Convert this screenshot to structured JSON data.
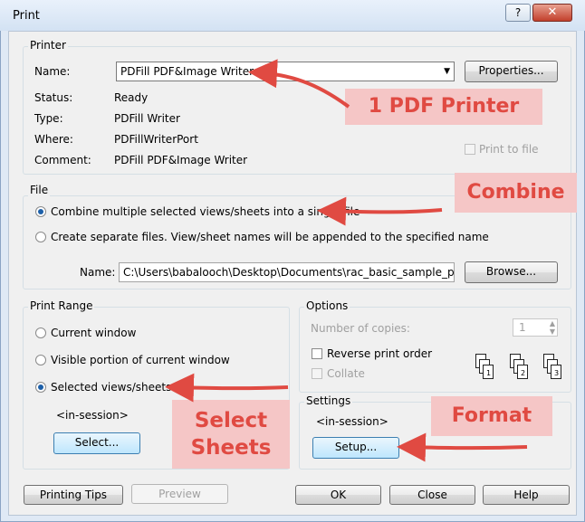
{
  "window": {
    "title": "Print",
    "help_label": "?",
    "close_label": "✕"
  },
  "printer": {
    "group_label": "Printer",
    "name_label": "Name:",
    "name_value": "PDFill PDF&Image Writer",
    "properties_label": "Properties...",
    "status_label": "Status:",
    "status_value": "Ready",
    "type_label": "Type:",
    "type_value": "PDFill Writer",
    "where_label": "Where:",
    "where_value": "PDFillWriterPort",
    "comment_label": "Comment:",
    "comment_value": "PDFill PDF&Image Writer",
    "print_to_file_label": "Print to file"
  },
  "file": {
    "group_label": "File",
    "combine_label": "Combine multiple selected views/sheets into a single file",
    "separate_label": "Create separate files. View/sheet names will be appended to the specified name",
    "name_label": "Name:",
    "name_value": "C:\\Users\\babalooch\\Desktop\\Documents\\rac_basic_sample_project.R",
    "browse_label": "Browse..."
  },
  "print_range": {
    "group_label": "Print Range",
    "current_window_label": "Current window",
    "visible_portion_label": "Visible portion of current window",
    "selected_label": "Selected views/sheets",
    "session_label": "<in-session>",
    "select_label": "Select..."
  },
  "options": {
    "group_label": "Options",
    "copies_label": "Number of copies:",
    "copies_value": "1",
    "reverse_label": "Reverse print order",
    "collate_label": "Collate",
    "page_numbers_a": [
      "1",
      "2",
      "3"
    ]
  },
  "settings": {
    "group_label": "Settings",
    "session_label": "<in-session>",
    "setup_label": "Setup..."
  },
  "footer": {
    "tips_label": "Printing Tips",
    "preview_label": "Preview",
    "ok_label": "OK",
    "close_label": "Close",
    "help_label": "Help"
  },
  "annotations": {
    "pdf_printer": "1 PDF Printer",
    "combine": "Combine",
    "select_line1": "Select",
    "select_line2": "Sheets",
    "format": "Format"
  },
  "colors": {
    "arrow": "#e04a42",
    "callout_bg": "#f5c6c6"
  }
}
